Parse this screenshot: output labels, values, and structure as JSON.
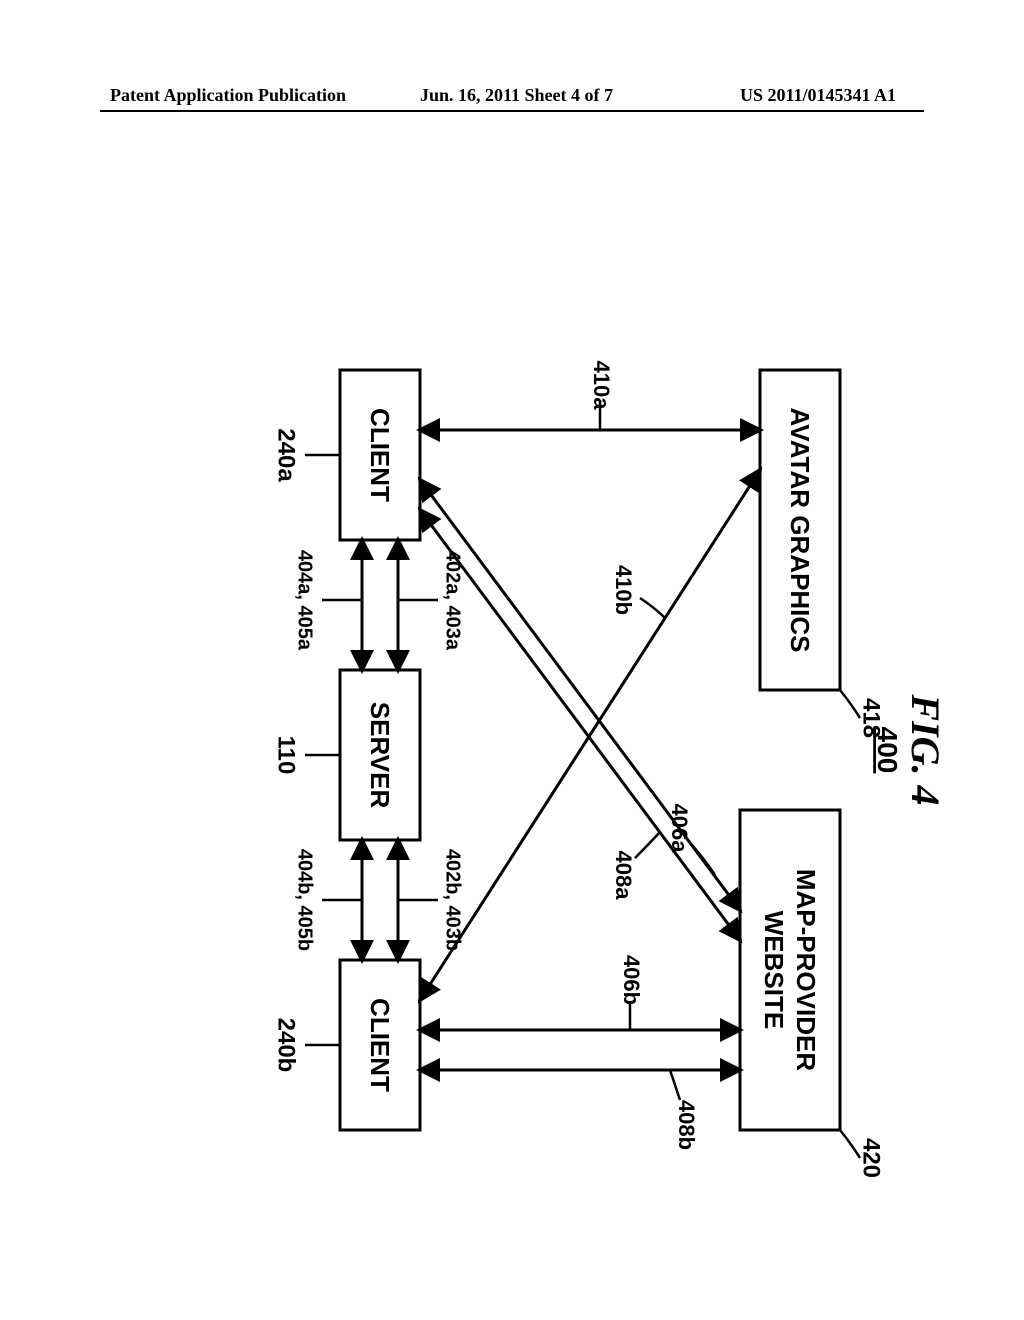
{
  "header": {
    "left": "Patent Application Publication",
    "center": "Jun. 16, 2011  Sheet 4 of 7",
    "right": "US 2011/0145341 A1"
  },
  "figure": {
    "title": "FIG.  4",
    "number": "400"
  },
  "boxes": {
    "avatar": {
      "label": "AVATAR GRAPHICS",
      "ref": "418"
    },
    "map": {
      "line1": "MAP-PROVIDER",
      "line2": "WEBSITE",
      "ref": "420"
    },
    "server": {
      "label": "SERVER",
      "ref": "110"
    },
    "clientA": {
      "label": "CLIENT",
      "ref": "240a"
    },
    "clientB": {
      "label": "CLIENT",
      "ref": "240b"
    }
  },
  "edges": {
    "avatar_clientA": "410a",
    "avatar_clientB": "410b",
    "map_clientA": "406a",
    "map_clientB": "406b",
    "map_clientA_r": "408a",
    "map_clientB_r": "408b",
    "clientA_server_top": "402a, 403a",
    "clientA_server_bot": "404a, 405a",
    "clientB_server_top": "402b, 403b",
    "clientB_server_bot": "404b, 405b"
  }
}
